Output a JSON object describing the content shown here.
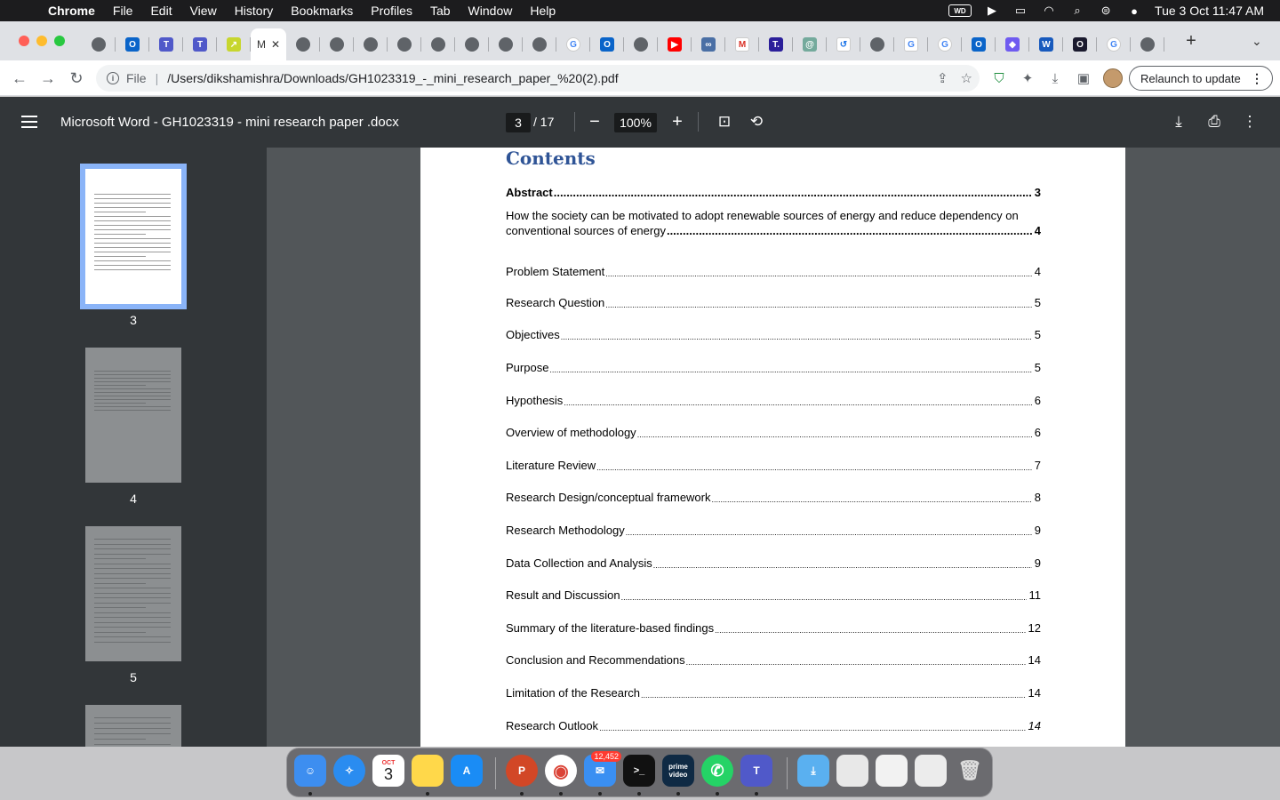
{
  "menubar": {
    "app": "Chrome",
    "items": [
      "File",
      "Edit",
      "View",
      "History",
      "Bookmarks",
      "Profiles",
      "Tab",
      "Window",
      "Help"
    ],
    "wd_label": "WD",
    "clock": "Tue 3 Oct  11:47 AM"
  },
  "tabs": {
    "active_title": "M",
    "favicons": [
      {
        "icon": "chrome-icon",
        "color": "#5f6368",
        "glyph": ""
      },
      {
        "icon": "outlook-icon",
        "color": "#0a64c9",
        "glyph": "O"
      },
      {
        "icon": "teams-icon",
        "color": "#5059c9",
        "glyph": "T"
      },
      {
        "icon": "teams-icon",
        "color": "#5059c9",
        "glyph": "T"
      },
      {
        "icon": "arrow-icon",
        "color": "#c7d62e",
        "glyph": "↗"
      }
    ],
    "favicons_after": [
      {
        "icon": "chrome-icon",
        "color": "#5f6368",
        "glyph": ""
      },
      {
        "icon": "chrome-icon",
        "color": "#5f6368",
        "glyph": ""
      },
      {
        "icon": "chrome-icon",
        "color": "#5f6368",
        "glyph": ""
      },
      {
        "icon": "chrome-icon",
        "color": "#5f6368",
        "glyph": ""
      },
      {
        "icon": "chrome-icon",
        "color": "#5f6368",
        "glyph": ""
      },
      {
        "icon": "chrome-icon",
        "color": "#5f6368",
        "glyph": ""
      },
      {
        "icon": "chrome-icon",
        "color": "#5f6368",
        "glyph": ""
      },
      {
        "icon": "openai-icon",
        "color": "#5f6368",
        "glyph": ""
      },
      {
        "icon": "google-icon",
        "color": "#ffffff",
        "glyph": "G"
      },
      {
        "icon": "outlook-icon",
        "color": "#0a64c9",
        "glyph": "O"
      },
      {
        "icon": "openai-icon",
        "color": "#5f6368",
        "glyph": ""
      },
      {
        "icon": "youtube-icon",
        "color": "#ff0000",
        "glyph": "▶"
      },
      {
        "icon": "link-icon",
        "color": "#4a6fa5",
        "glyph": "∞"
      },
      {
        "icon": "gmail-icon",
        "color": "#ffffff",
        "glyph": "M"
      },
      {
        "icon": "t-icon",
        "color": "#2b1f9a",
        "glyph": "T."
      },
      {
        "icon": "chatgpt-icon",
        "color": "#74aa9c",
        "glyph": "@"
      },
      {
        "icon": "history-icon",
        "color": "#ffffff",
        "glyph": "↺"
      },
      {
        "icon": "openai-icon",
        "color": "#5f6368",
        "glyph": ""
      },
      {
        "icon": "grammarly-icon",
        "color": "#ffffff",
        "glyph": "G"
      },
      {
        "icon": "google-icon",
        "color": "#ffffff",
        "glyph": "G"
      },
      {
        "icon": "outlook-icon",
        "color": "#0a64c9",
        "glyph": "O"
      },
      {
        "icon": "copilot-icon",
        "color": "#6f5bf0",
        "glyph": "◆"
      },
      {
        "icon": "word-icon",
        "color": "#185abd",
        "glyph": "W"
      },
      {
        "icon": "o-icon",
        "color": "#1a1a2e",
        "glyph": "O"
      },
      {
        "icon": "google-icon",
        "color": "#ffffff",
        "glyph": "G"
      },
      {
        "icon": "openai-icon",
        "color": "#5f6368",
        "glyph": ""
      }
    ]
  },
  "address": {
    "scheme": "File",
    "url": "/Users/dikshamishra/Downloads/GH1023319_-_mini_research_paper_%20(2).pdf",
    "relaunch": "Relaunch to update"
  },
  "pdf": {
    "title": "Microsoft Word - GH1023319 - mini research paper .docx",
    "page_current": "3",
    "page_total": "/  17",
    "zoom": "100%",
    "thumbnails": [
      "3",
      "4",
      "5"
    ]
  },
  "toc": {
    "heading": "Contents",
    "abstract": {
      "label": "Abstract ",
      "page": "3"
    },
    "long_entry": {
      "line1": "How the society can be motivated to adopt renewable sources of energy and reduce dependency on",
      "line2": "conventional sources of energy",
      "page": "4"
    },
    "entries": [
      {
        "label": "Problem Statement",
        "page": " 4"
      },
      {
        "label": "Research Question",
        "page": " 5"
      },
      {
        "label": "Objectives ",
        "page": " 5"
      },
      {
        "label": "Purpose",
        "page": " 5"
      },
      {
        "label": "Hypothesis ",
        "page": " 6"
      },
      {
        "label": "Overview of methodology ",
        "page": " 6"
      },
      {
        "label": "Literature Review",
        "page": " 7"
      },
      {
        "label": "Research Design/conceptual framework",
        "page": " 8"
      },
      {
        "label": "Research Methodology",
        "page": " 9"
      },
      {
        "label": "Data Collection and Analysis",
        "page": " 9"
      },
      {
        "label": "Result and Discussion ",
        "page": " 11"
      },
      {
        "label": "Summary of the literature-based findings",
        "page": " 12"
      },
      {
        "label": "Conclusion and Recommendations ",
        "page": " 14"
      },
      {
        "label": "Limitation of the Research",
        "page": " 14"
      },
      {
        "label": "Research Outlook",
        "page": "14"
      }
    ]
  },
  "dock": {
    "calendar_month": "OCT",
    "calendar_day": "3",
    "mail_badge": "12,452",
    "prime_label": "prime video"
  }
}
